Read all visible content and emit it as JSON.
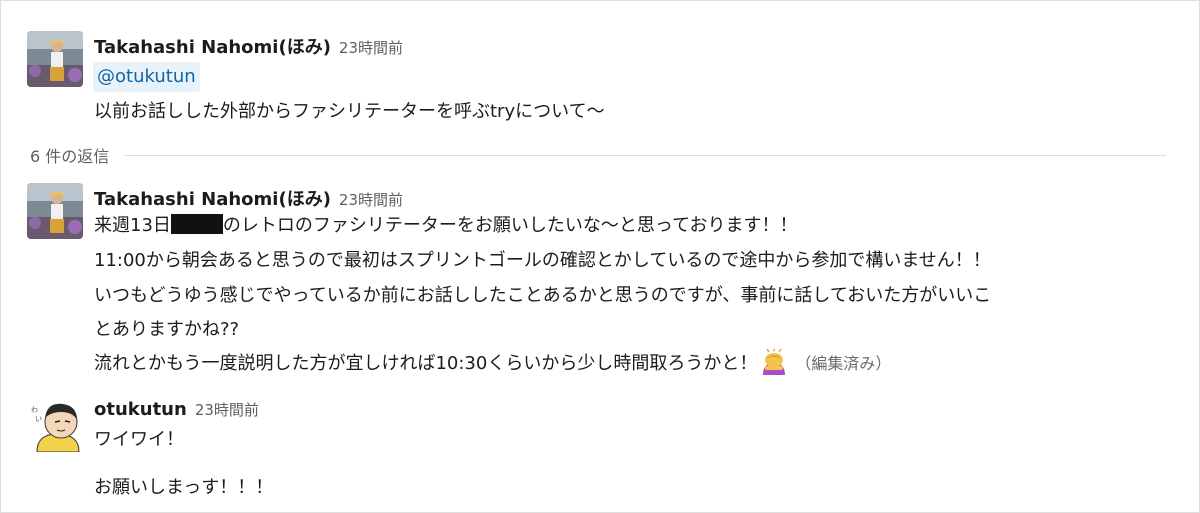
{
  "thread": {
    "parent": {
      "author": "Takahashi Nahomi(ほみ)",
      "timestamp": "23時間前",
      "mention": "@otukutun",
      "text": "以前お話しした外部からファシリテーターを呼ぶtryについて〜"
    },
    "reply_count_label": "6 件の返信",
    "replies": [
      {
        "author": "Takahashi Nahomi(ほみ)",
        "timestamp": "23時間前",
        "line1_before": "来週13日",
        "line1_after": "のレトロのファシリテーターをお願いしたいな〜と思っております！！",
        "line2": "11:00から朝会あると思うので最初はスプリントゴールの確認とかしているので途中から参加で構いません！！",
        "line3": "いつもどうゆう感じでやっているか前にお話ししたことあるかと思うのですが、事前に話しておいた方がいいこ",
        "line4": "とありますかね??",
        "line5": "流れとかもう一度説明した方が宜しければ10:30くらいから少し時間取ろうかと！",
        "emoji": "person-bowing-emoji",
        "edited_label": "（編集済み）"
      },
      {
        "author": "otukutun",
        "timestamp": "23時間前",
        "line1": "ワイワイ！",
        "line2": "お願いしまっす！！！"
      }
    ]
  },
  "colors": {
    "mention_bg": "#e8f2fb",
    "mention_text": "#1264a3",
    "muted": "#616061"
  }
}
